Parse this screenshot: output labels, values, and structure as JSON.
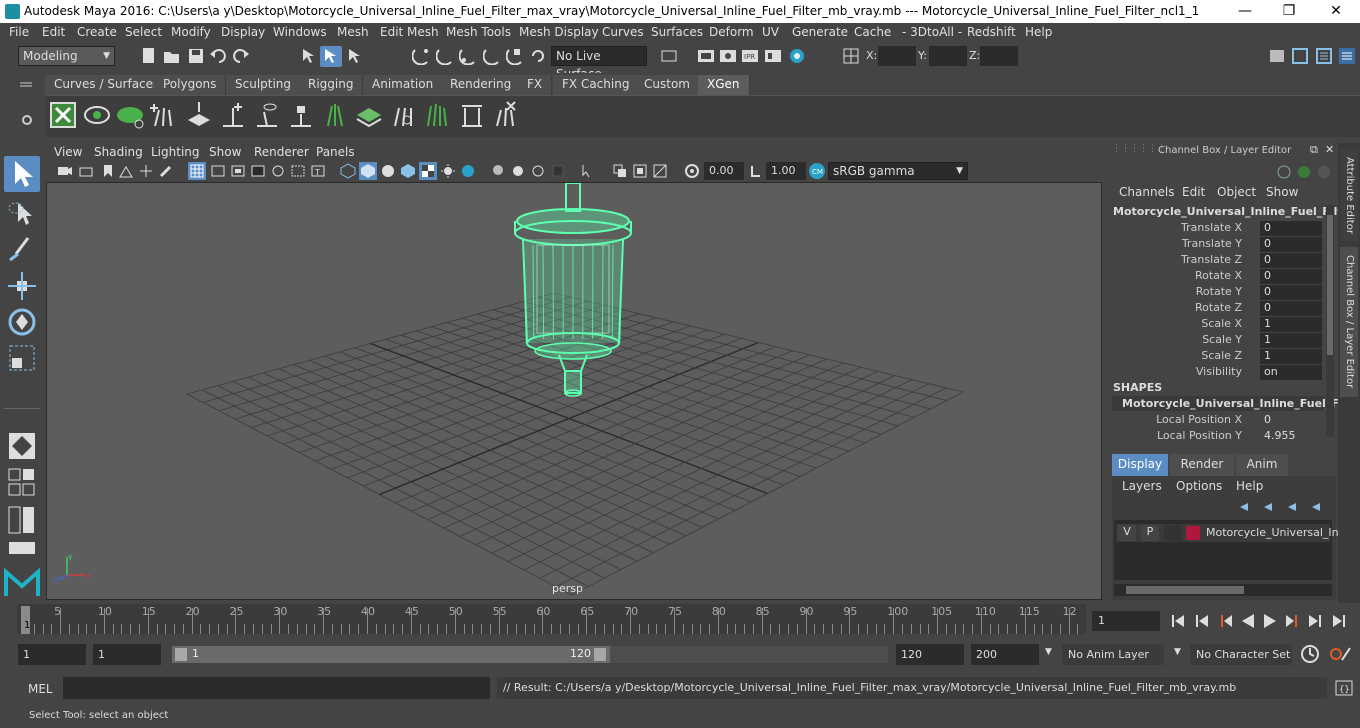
{
  "window": {
    "title": "Autodesk Maya 2016: C:\\Users\\a y\\Desktop\\Motorcycle_Universal_Inline_Fuel_Filter_max_vray\\Motorcycle_Universal_Inline_Fuel_Filter_mb_vray.mb   ---   Motorcycle_Universal_Inline_Fuel_Filter_ncl1_1",
    "minimize": "—",
    "maximize": "❐",
    "close": "✕"
  },
  "menubar": [
    "File",
    "Edit",
    "Create",
    "Select",
    "Modify",
    "Display",
    "Windows",
    "Mesh",
    "Edit Mesh",
    "Mesh Tools",
    "Mesh Display",
    "Curves",
    "Surfaces",
    "Deform",
    "UV",
    "Generate",
    "Cache",
    "- 3DtoAll -",
    "Redshift",
    "Help"
  ],
  "statusline": {
    "mode": "Modeling",
    "live_surface": "No Live Surface",
    "x_label": "X:",
    "y_label": "Y:",
    "z_label": "Z:"
  },
  "shelf": {
    "tabs": [
      "Curves / Surfaces",
      "Polygons",
      "Sculpting",
      "Rigging",
      "Animation",
      "Rendering",
      "FX",
      "FX Caching",
      "Custom",
      "XGen"
    ],
    "active_tab": "XGen"
  },
  "viewport": {
    "menus": [
      "View",
      "Shading",
      "Lighting",
      "Show",
      "Renderer",
      "Panels"
    ],
    "exposure": "0.00",
    "gamma": "1.00",
    "color_space": "sRGB gamma",
    "camera_label": "persp",
    "axis": {
      "x": "x",
      "y": "y",
      "z": "z"
    },
    "wire_color": "#5fffb0"
  },
  "channel_box": {
    "header": "Channel Box / Layer Editor",
    "menus": [
      "Channels",
      "Edit",
      "Object",
      "Show"
    ],
    "object_name": "Motorcycle_Universal_Inline_Fuel_Filt...",
    "channels": [
      {
        "label": "Translate X",
        "value": "0"
      },
      {
        "label": "Translate Y",
        "value": "0"
      },
      {
        "label": "Translate Z",
        "value": "0"
      },
      {
        "label": "Rotate X",
        "value": "0"
      },
      {
        "label": "Rotate Y",
        "value": "0"
      },
      {
        "label": "Rotate Z",
        "value": "0"
      },
      {
        "label": "Scale X",
        "value": "1"
      },
      {
        "label": "Scale Y",
        "value": "1"
      },
      {
        "label": "Scale Z",
        "value": "1"
      },
      {
        "label": "Visibility",
        "value": "on"
      }
    ],
    "shapes_title": "SHAPES",
    "shape_name": "Motorcycle_Universal_Inline_Fuel_Fil...",
    "shape_channels": [
      {
        "label": "Local Position X",
        "value": "0"
      },
      {
        "label": "Local Position Y",
        "value": "4.955"
      }
    ]
  },
  "layer_editor": {
    "tabs": [
      "Display",
      "Render",
      "Anim"
    ],
    "active_tab": "Display",
    "menus": [
      "Layers",
      "Options",
      "Help"
    ],
    "layer": {
      "v": "V",
      "p": "P",
      "name": "Motorcycle_Universal_Inl",
      "color": "#b0173c"
    }
  },
  "side_tabs": [
    "Attribute Editor",
    "Channel Box / Layer Editor"
  ],
  "timeline": {
    "ticks": [
      "5",
      "10",
      "15",
      "20",
      "25",
      "30",
      "35",
      "40",
      "45",
      "50",
      "55",
      "60",
      "65",
      "70",
      "75",
      "80",
      "85",
      "90",
      "95",
      "100",
      "105",
      "110",
      "115",
      "12"
    ],
    "current_marker": "1",
    "current_frame": "1"
  },
  "range": {
    "start": "1",
    "playback_start": "1",
    "slider_start": "1",
    "slider_end": "120",
    "playback_end": "120",
    "end": "200",
    "anim_layer": "No Anim Layer",
    "character_set": "No Character Set"
  },
  "command": {
    "lang": "MEL",
    "result": "// Result: C:/Users/a y/Desktop/Motorcycle_Universal_Inline_Fuel_Filter_max_vray/Motorcycle_Universal_Inline_Fuel_Filter_mb_vray.mb"
  },
  "help_line": "Select Tool: select an object"
}
